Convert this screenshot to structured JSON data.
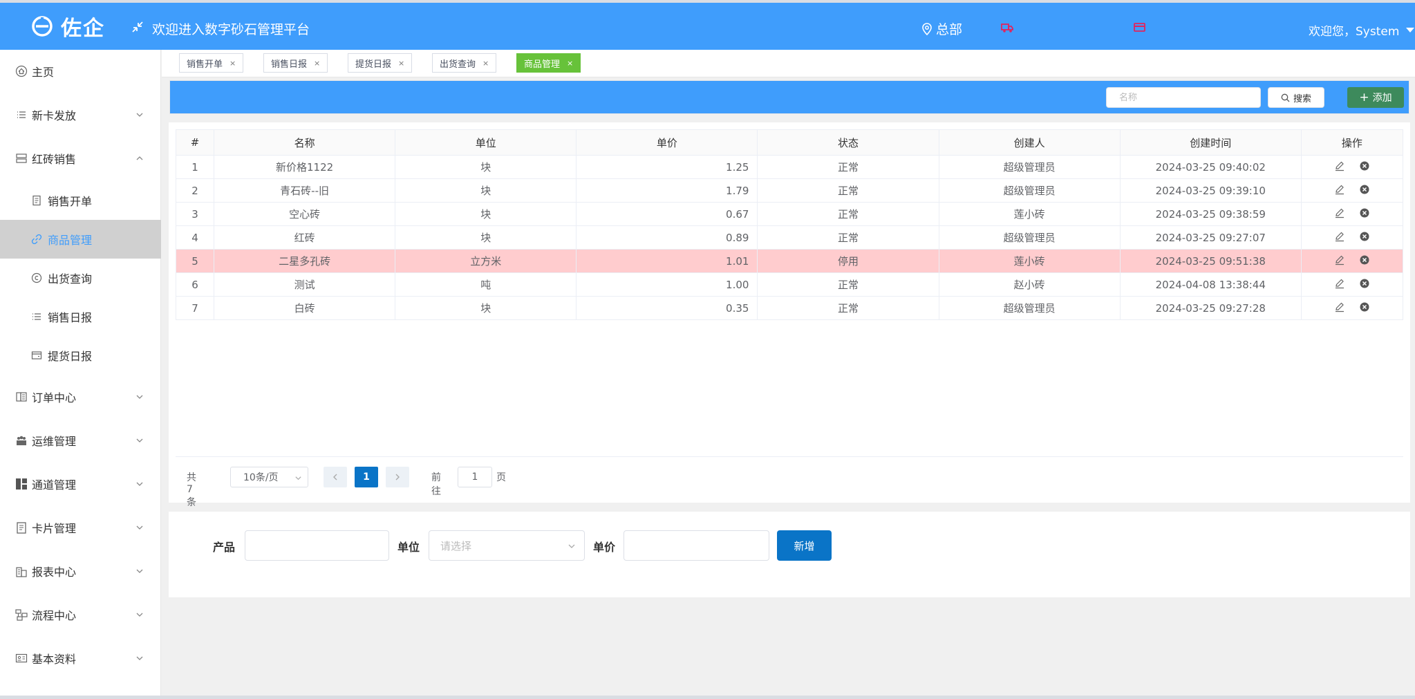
{
  "header": {
    "logo_text": "佐企",
    "title": "欢迎进入数字砂石管理平台",
    "location": "总部",
    "welcome": "欢迎您，System"
  },
  "sidebar": {
    "items": [
      {
        "label": "主页",
        "icon": "home-icon"
      },
      {
        "label": "新卡发放",
        "icon": "list-icon"
      },
      {
        "label": "红砖销售",
        "icon": "storage-icon"
      },
      {
        "label": "销售开单",
        "icon": "document-icon"
      },
      {
        "label": "商品管理",
        "icon": "link-icon"
      },
      {
        "label": "出货查询",
        "icon": "copyright-icon"
      },
      {
        "label": "销售日报",
        "icon": "lines-icon"
      },
      {
        "label": "提货日报",
        "icon": "wallet-icon"
      },
      {
        "label": "订单中心",
        "icon": "book-icon"
      },
      {
        "label": "运维管理",
        "icon": "people-icon"
      },
      {
        "label": "通道管理",
        "icon": "grid-icon"
      },
      {
        "label": "卡片管理",
        "icon": "clipboard-icon"
      },
      {
        "label": "报表中心",
        "icon": "building-icon"
      },
      {
        "label": "流程中心",
        "icon": "flow-icon"
      },
      {
        "label": "基本资料",
        "icon": "id-card-icon"
      }
    ]
  },
  "tabs": [
    {
      "label": "销售开单"
    },
    {
      "label": "销售日报"
    },
    {
      "label": "提货日报"
    },
    {
      "label": "出货查询"
    },
    {
      "label": "商品管理"
    }
  ],
  "toolbar": {
    "search_placeholder": "名称",
    "search_label": "搜索",
    "add_label": "添加"
  },
  "table": {
    "headers": [
      "#",
      "名称",
      "单位",
      "单价",
      "状态",
      "创建人",
      "创建时间",
      "操作"
    ],
    "rows": [
      [
        "1",
        "新价格1122",
        "块",
        "1.25",
        "正常",
        "超级管理员",
        "2024-03-25 09:40:02"
      ],
      [
        "2",
        "青石砖--旧",
        "块",
        "1.79",
        "正常",
        "超级管理员",
        "2024-03-25 09:39:10"
      ],
      [
        "3",
        "空心砖",
        "块",
        "0.67",
        "正常",
        "莲小砖",
        "2024-03-25 09:38:59"
      ],
      [
        "4",
        "红砖",
        "块",
        "0.89",
        "正常",
        "超级管理员",
        "2024-03-25 09:27:07"
      ],
      [
        "5",
        "二星多孔砖",
        "立方米",
        "1.01",
        "停用",
        "莲小砖",
        "2024-03-25 09:51:38"
      ],
      [
        "6",
        "测试",
        "吨",
        "1.00",
        "正常",
        "赵小砖",
        "2024-04-08 13:38:44"
      ],
      [
        "7",
        "白砖",
        "块",
        "0.35",
        "正常",
        "超级管理员",
        "2024-03-25 09:27:28"
      ]
    ]
  },
  "pagination": {
    "total": "共 7 条",
    "page_size": "10条/页",
    "current_page": "1",
    "goto_label": "前往",
    "goto_value": "1",
    "page_suffix": "页"
  },
  "form": {
    "product_label": "产品",
    "unit_label": "单位",
    "unit_placeholder": "请选择",
    "price_label": "单价",
    "submit_label": "新增"
  }
}
